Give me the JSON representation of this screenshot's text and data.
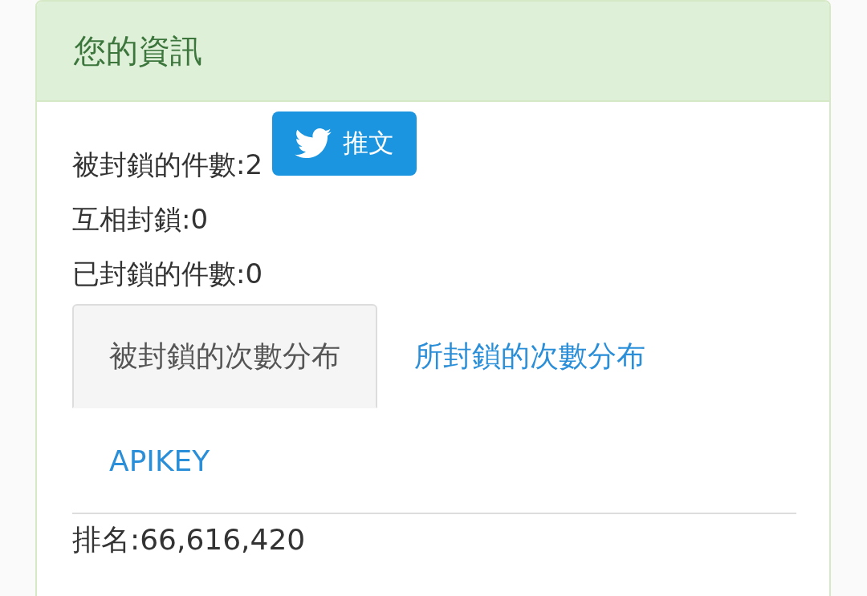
{
  "panel": {
    "title": "您的資訊"
  },
  "stats": [
    {
      "label": "被封鎖的件數:2",
      "tweet_button": "推文"
    },
    {
      "label": "互相封鎖:0"
    },
    {
      "label": "已封鎖的件數:0"
    }
  ],
  "tabs": [
    {
      "label": "被封鎖的次數分布",
      "selected": true
    },
    {
      "label": "所封鎖的次數分布",
      "selected": false
    },
    {
      "label": "APIKEY",
      "selected": false
    }
  ],
  "rank": "排名:66,616,420"
}
